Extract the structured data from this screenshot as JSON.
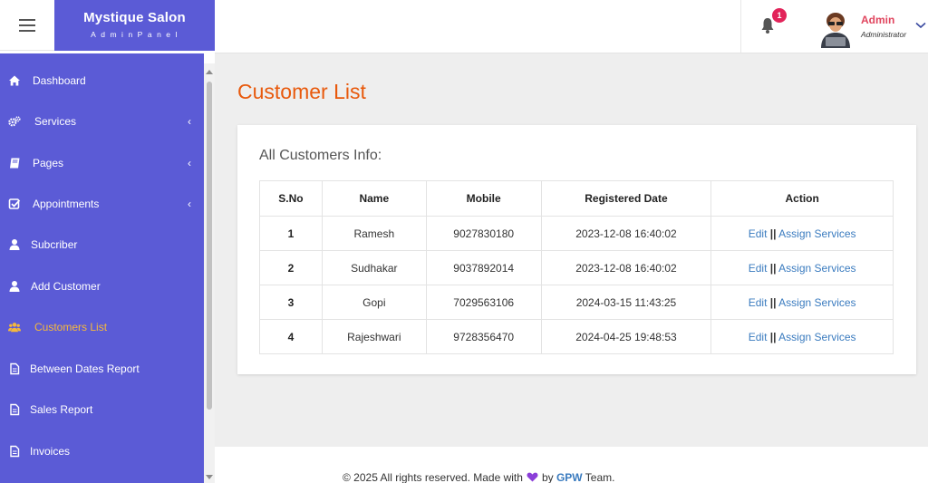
{
  "brand": {
    "title": "Mystique Salon",
    "subtitle": "AdminPanel"
  },
  "header": {
    "notification_count": "1",
    "user_name": "Admin",
    "user_role": "Administrator"
  },
  "sidebar": {
    "items": [
      {
        "label": "Dashboard",
        "icon": "home-icon"
      },
      {
        "label": "Services",
        "icon": "gears-icon"
      },
      {
        "label": "Pages",
        "icon": "book-icon"
      },
      {
        "label": "Appointments",
        "icon": "check-square-icon"
      },
      {
        "label": "Subcriber",
        "icon": "user-icon"
      },
      {
        "label": "Add Customer",
        "icon": "user-icon"
      },
      {
        "label": "Customers List",
        "icon": "users-icon"
      },
      {
        "label": "Between Dates Report",
        "icon": "file-icon"
      },
      {
        "label": "Sales Report",
        "icon": "file-icon"
      },
      {
        "label": "Invoices",
        "icon": "file-icon"
      }
    ]
  },
  "main": {
    "page_title": "Customer List",
    "card_title": "All Customers Info:",
    "table": {
      "columns": [
        "S.No",
        "Name",
        "Mobile",
        "Registered Date",
        "Action"
      ],
      "rows": [
        {
          "sno": "1",
          "name": "Ramesh",
          "mobile": "9027830180",
          "date": "2023-12-08 16:40:02"
        },
        {
          "sno": "2",
          "name": "Sudhakar",
          "mobile": "9037892014",
          "date": "2023-12-08 16:40:02"
        },
        {
          "sno": "3",
          "name": "Gopi",
          "mobile": "7029563106",
          "date": "2024-03-15 11:43:25"
        },
        {
          "sno": "4",
          "name": "Rajeshwari",
          "mobile": "9728356470",
          "date": "2024-04-25 19:48:53"
        }
      ],
      "action_edit": "Edit",
      "action_separator": "||",
      "action_assign": "Assign Services"
    }
  },
  "footer": {
    "text_before": "© 2025 All rights reserved. Made with",
    "text_by": "by",
    "team": "GPW",
    "text_after": "Team."
  },
  "colors": {
    "sidebar": "#5b5bd6",
    "accent": "#e8590c",
    "active": "#f5b83d",
    "link": "#3a7bbf",
    "badge": "#e2245a"
  }
}
